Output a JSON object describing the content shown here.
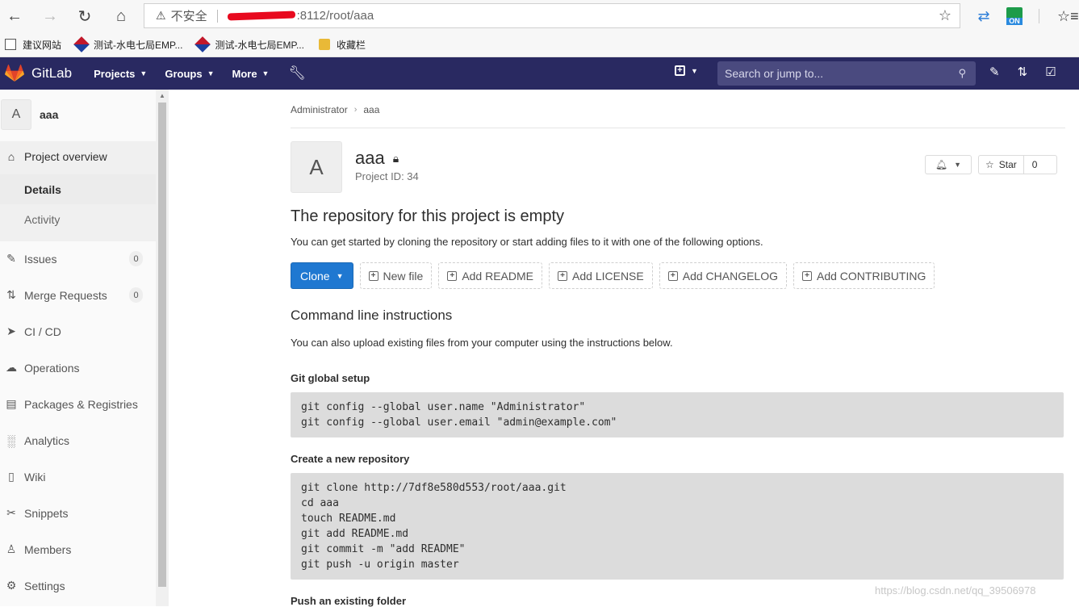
{
  "browser": {
    "security_label": "不安全",
    "url_visible": ":8112/root/aaa",
    "bookmarks": [
      "建议网站",
      "测试-水电七局EMP...",
      "测试-水电七局EMP...",
      "收藏栏"
    ],
    "ext_badge": "ON"
  },
  "navbar": {
    "brand": "GitLab",
    "menus": [
      "Projects",
      "Groups",
      "More"
    ],
    "search_placeholder": "Search or jump to..."
  },
  "sidebar": {
    "avatar_letter": "A",
    "project_name": "aaa",
    "overview_label": "Project overview",
    "sub_items": [
      "Details",
      "Activity"
    ],
    "items": [
      {
        "label": "Issues",
        "badge": "0"
      },
      {
        "label": "Merge Requests",
        "badge": "0"
      },
      {
        "label": "CI / CD"
      },
      {
        "label": "Operations"
      },
      {
        "label": "Packages & Registries"
      },
      {
        "label": "Analytics"
      },
      {
        "label": "Wiki"
      },
      {
        "label": "Snippets"
      },
      {
        "label": "Members"
      },
      {
        "label": "Settings"
      }
    ]
  },
  "main": {
    "breadcrumb": [
      "Administrator",
      "aaa"
    ],
    "avatar_letter": "A",
    "title": "aaa",
    "project_id": "Project ID: 34",
    "star_label": "Star",
    "star_count": "0",
    "empty_title": "The repository for this project is empty",
    "empty_desc": "You can get started by cloning the repository or start adding files to it with one of the following options.",
    "buttons": {
      "clone": "Clone",
      "new_file": "New file",
      "add_readme": "Add README",
      "add_license": "Add LICENSE",
      "add_changelog": "Add CHANGELOG",
      "add_contributing": "Add CONTRIBUTING"
    },
    "cli_title": "Command line instructions",
    "cli_desc": "You can also upload existing files from your computer using the instructions below.",
    "git_global_title": "Git global setup",
    "git_global_code": "git config --global user.name \"Administrator\"\ngit config --global user.email \"admin@example.com\"",
    "new_repo_title": "Create a new repository",
    "new_repo_code": "git clone http://7df8e580d553/root/aaa.git\ncd aaa\ntouch README.md\ngit add README.md\ngit commit -m \"add README\"\ngit push -u origin master",
    "push_folder_title": "Push an existing folder"
  },
  "watermark": "https://blog.csdn.net/qq_39506978"
}
